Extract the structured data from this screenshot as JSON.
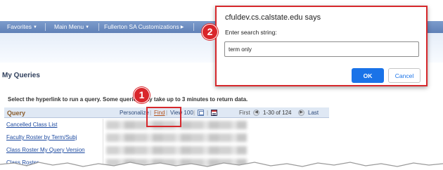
{
  "nav": {
    "items": [
      {
        "label": "Favorites"
      },
      {
        "label": "Main Menu"
      },
      {
        "label": "Fullerton SA Customizations"
      }
    ]
  },
  "page": {
    "title": "My Queries",
    "instructions": "Select the hyperlink to run a query. Some queries may take up to 3 minutes to return data."
  },
  "grid": {
    "column_header": "Query",
    "toolbar": {
      "personalize": "Personalize",
      "find": "Find",
      "view": "View 100",
      "first": "First",
      "range": "1-30 of 124",
      "last": "Last"
    },
    "rows": [
      {
        "name": "Cancelled Class List"
      },
      {
        "name": "Faculty Roster by Term/Subj"
      },
      {
        "name": "Class Roster My Query Version"
      },
      {
        "name": "Class Roster"
      }
    ]
  },
  "dialog": {
    "title": "cfuldev.cs.calstate.edu says",
    "message": "Enter search string:",
    "input_value": "term only",
    "ok_label": "OK",
    "cancel_label": "Cancel"
  },
  "annotations": {
    "step1": "1",
    "step2": "2"
  },
  "colors": {
    "annotation_red": "#d6282c",
    "primary_button": "#1a73e8",
    "nav_blue": "#6a8ac0"
  }
}
